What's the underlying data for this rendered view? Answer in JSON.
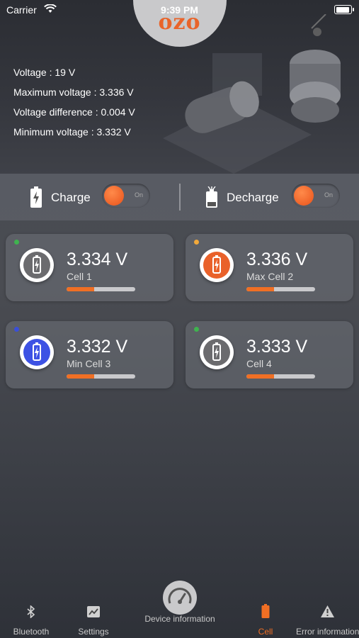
{
  "status_bar": {
    "carrier": "Carrier",
    "time": "9:39 PM"
  },
  "logo": "ozo",
  "stats": {
    "voltage": "Voltage : 19 V",
    "max_voltage": "Maximum voltage : 3.336 V",
    "voltage_diff": "Voltage difference : 0.004 V",
    "min_voltage": "Minimum voltage : 3.332 V"
  },
  "toggles": {
    "charge": {
      "label": "Charge",
      "state": "On"
    },
    "discharge": {
      "label": "Decharge",
      "state": "On"
    }
  },
  "cells": [
    {
      "value": "3.334 V",
      "label": "Cell 1",
      "dot_color": "#3fb34f",
      "icon_color": "#6b6b6e",
      "level": 0.4
    },
    {
      "value": "3.336 V",
      "label": "Max Cell 2",
      "dot_color": "#f2a93b",
      "icon_color": "#e9612a",
      "level": 0.4
    },
    {
      "value": "3.332 V",
      "label": "Min Cell 3",
      "dot_color": "#3a4fd8",
      "icon_color": "#3d52e4",
      "level": 0.4
    },
    {
      "value": "3.333 V",
      "label": "Cell 4",
      "dot_color": "#3fb34f",
      "icon_color": "#6b6b6e",
      "level": 0.4
    }
  ],
  "tabs": {
    "bluetooth": "Bluetooth",
    "settings": "Settings",
    "device_info": "Device information",
    "cell": "Cell",
    "error_info": "Error information"
  },
  "colors": {
    "accent": "#f06f24",
    "active_tab": "#f06f24"
  }
}
